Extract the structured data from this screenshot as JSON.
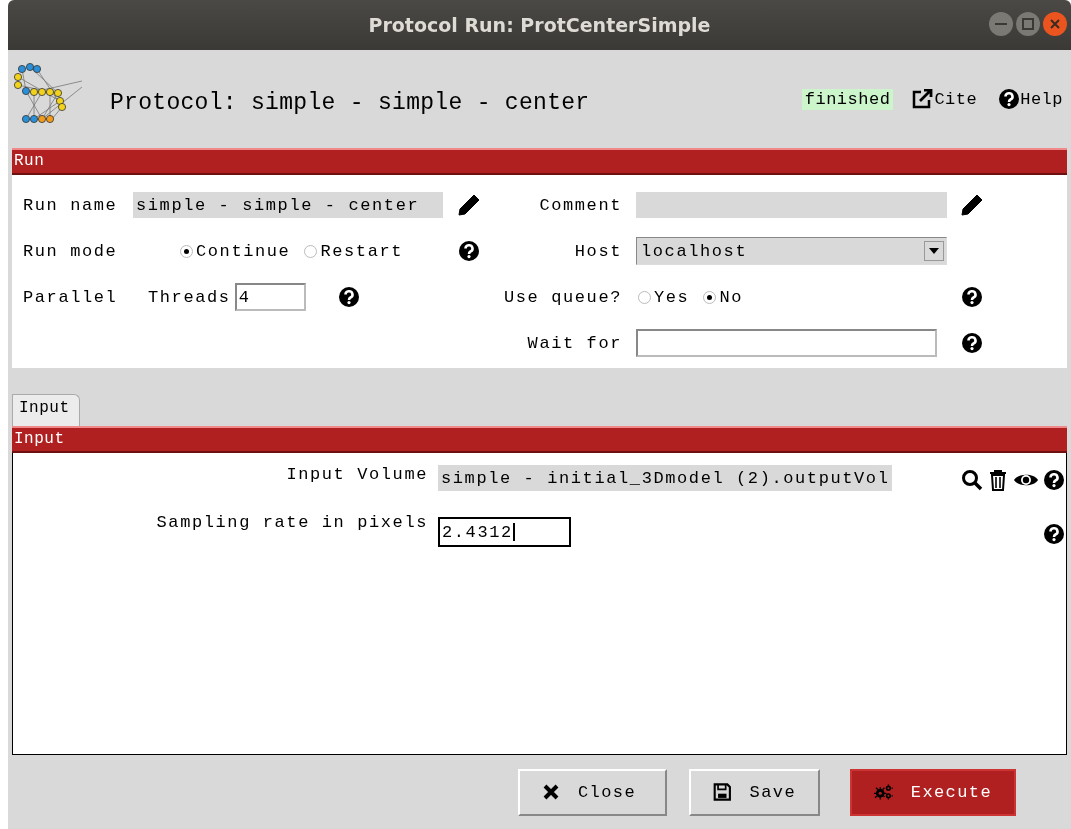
{
  "window": {
    "title": "Protocol Run: ProtCenterSimple"
  },
  "header": {
    "title": "Protocol: simple - simple - center",
    "status": "finished",
    "links": [
      {
        "label": "Cite",
        "kind": "cite"
      },
      {
        "label": "Help",
        "kind": "help"
      }
    ]
  },
  "run_section": {
    "title": "Run",
    "run_name": {
      "label": "Run name",
      "value": "simple - simple - center"
    },
    "comment": {
      "label": "Comment"
    },
    "run_mode": {
      "label": "Run mode",
      "options": [
        {
          "label": "Continue",
          "selected": true
        },
        {
          "label": "Restart",
          "selected": false
        }
      ]
    },
    "host": {
      "label": "Host",
      "value": "localhost"
    },
    "parallel": {
      "label": "Parallel",
      "threads_label": "Threads",
      "threads": "4"
    },
    "use_queue": {
      "label": "Use queue?",
      "options": [
        {
          "label": "Yes",
          "selected": false
        },
        {
          "label": "No",
          "selected": true
        }
      ]
    },
    "wait_for": {
      "label": "Wait for"
    }
  },
  "tabs": [
    {
      "label": "Input",
      "selected": true
    }
  ],
  "input_section": {
    "title": "Input",
    "params": [
      {
        "kind": "pointer",
        "label": "Input Volume",
        "value": "simple - initial_3Dmodel (2).outputVol"
      },
      {
        "kind": "number",
        "label": "Sampling rate in pixels",
        "value": "2.4312"
      }
    ]
  },
  "buttons": [
    {
      "label": "Close",
      "kind": "close"
    },
    {
      "label": "Save",
      "kind": "save"
    },
    {
      "label": "Execute",
      "kind": "execute"
    }
  ]
}
